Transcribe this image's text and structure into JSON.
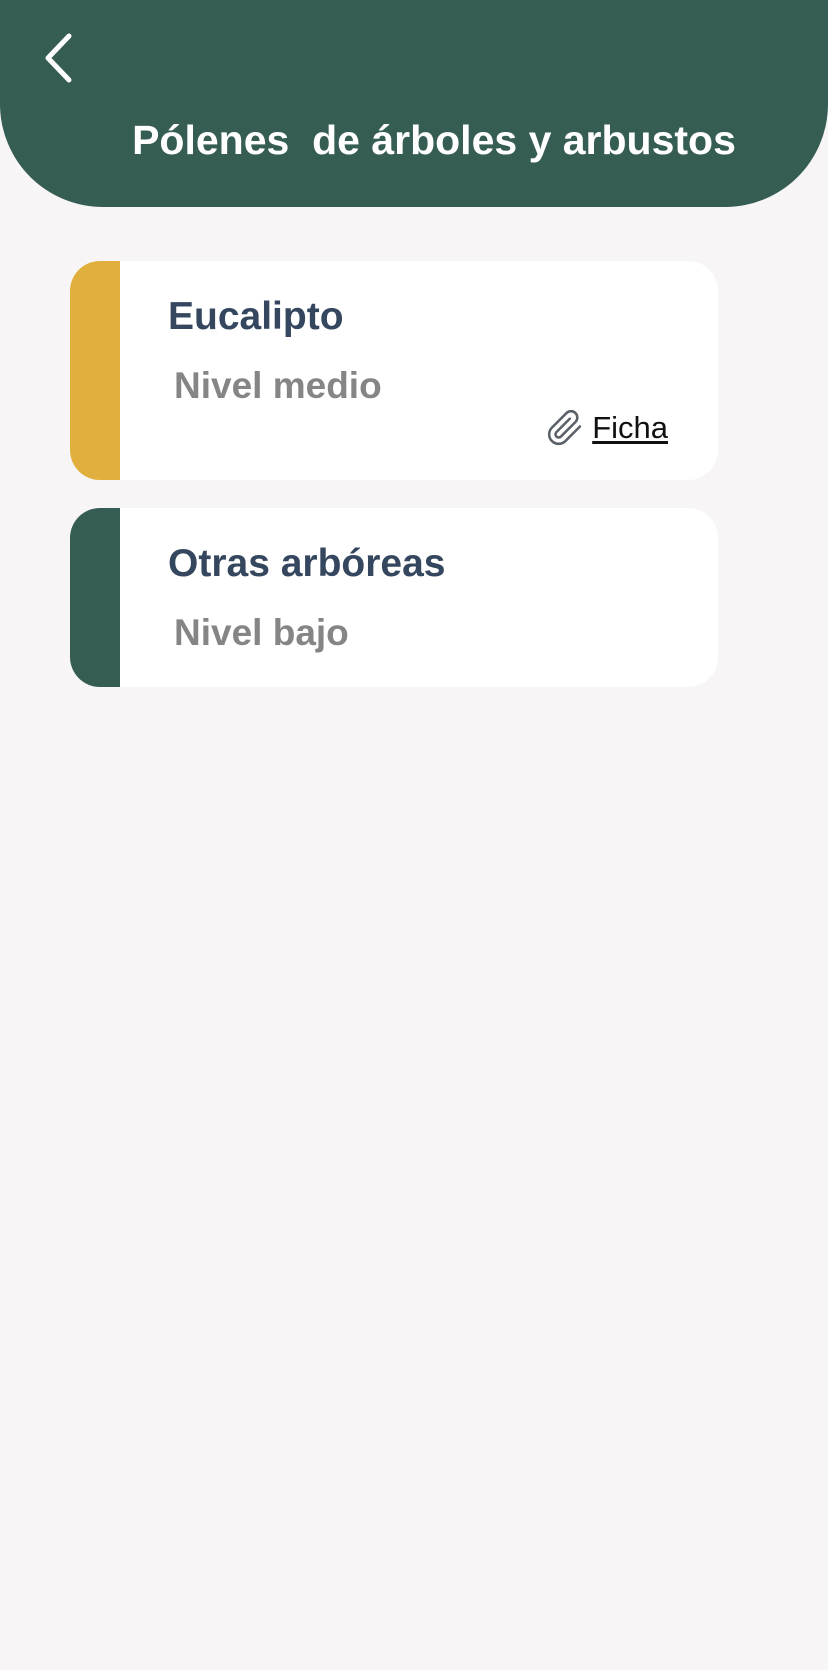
{
  "header": {
    "title": "Pólenes  de árboles y arbustos",
    "back_icon": "chevron-left-icon",
    "background_color": "#365d54"
  },
  "pollens": [
    {
      "name": "Eucalipto",
      "level": "Nivel medio",
      "level_color": "#e0af3e",
      "link": {
        "icon": "paperclip-icon",
        "label": "Ficha"
      }
    },
    {
      "name": "Otras arbóreas",
      "level": "Nivel bajo",
      "level_color": "#365d54"
    }
  ]
}
